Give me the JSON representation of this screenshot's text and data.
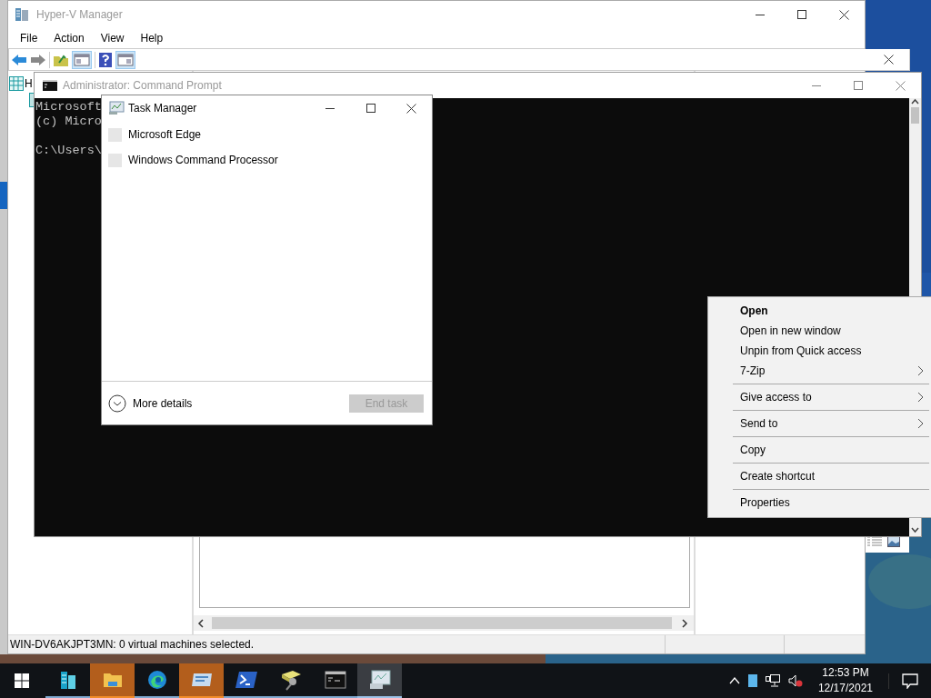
{
  "hyperv_window": {
    "title": "Hyper-V Manager",
    "menu": [
      "File",
      "Action",
      "View",
      "Help"
    ],
    "tree_item": "H",
    "status_bar": "WIN-DV6AKJPT3MN:  0 virtual machines selected."
  },
  "cmd_window": {
    "title": "Administrator: Command Prompt",
    "lines": [
      "Microsoft",
      "(c) Micro",
      "C:\\Users\\"
    ]
  },
  "task_manager": {
    "title": "Task Manager",
    "apps": [
      "Microsoft Edge",
      "Windows Command Processor"
    ],
    "more_details": "More details",
    "end_task": {
      "label": "End task",
      "disabled": true
    }
  },
  "context_menu": {
    "groups": [
      [
        {
          "label": "Open",
          "bold": true,
          "submenu": false
        },
        {
          "label": "Open in new window",
          "bold": false,
          "submenu": false
        },
        {
          "label": "Unpin from Quick access",
          "bold": false,
          "submenu": false
        },
        {
          "label": "7-Zip",
          "bold": false,
          "submenu": true
        }
      ],
      [
        {
          "label": "Give access to",
          "bold": false,
          "submenu": true
        }
      ],
      [
        {
          "label": "Send to",
          "bold": false,
          "submenu": true
        }
      ],
      [
        {
          "label": "Copy",
          "bold": false,
          "submenu": false
        }
      ],
      [
        {
          "label": "Create shortcut",
          "bold": false,
          "submenu": false
        }
      ],
      [
        {
          "label": "Properties",
          "bold": false,
          "submenu": false
        }
      ]
    ]
  },
  "taskbar": {
    "apps": [
      {
        "kind": "server",
        "flashing": false,
        "active": false
      },
      {
        "kind": "folder",
        "flashing": true,
        "active": false
      },
      {
        "kind": "browser",
        "flashing": false,
        "active": false
      },
      {
        "kind": "hyperv",
        "flashing": true,
        "active": false
      },
      {
        "kind": "powershell",
        "flashing": false,
        "active": false
      },
      {
        "kind": "tools",
        "flashing": false,
        "active": false
      },
      {
        "kind": "console",
        "flashing": false,
        "active": false
      },
      {
        "kind": "taskmgr",
        "flashing": false,
        "active": true
      }
    ],
    "clock": {
      "time": "12:53 PM",
      "date": "12/17/2021"
    }
  }
}
